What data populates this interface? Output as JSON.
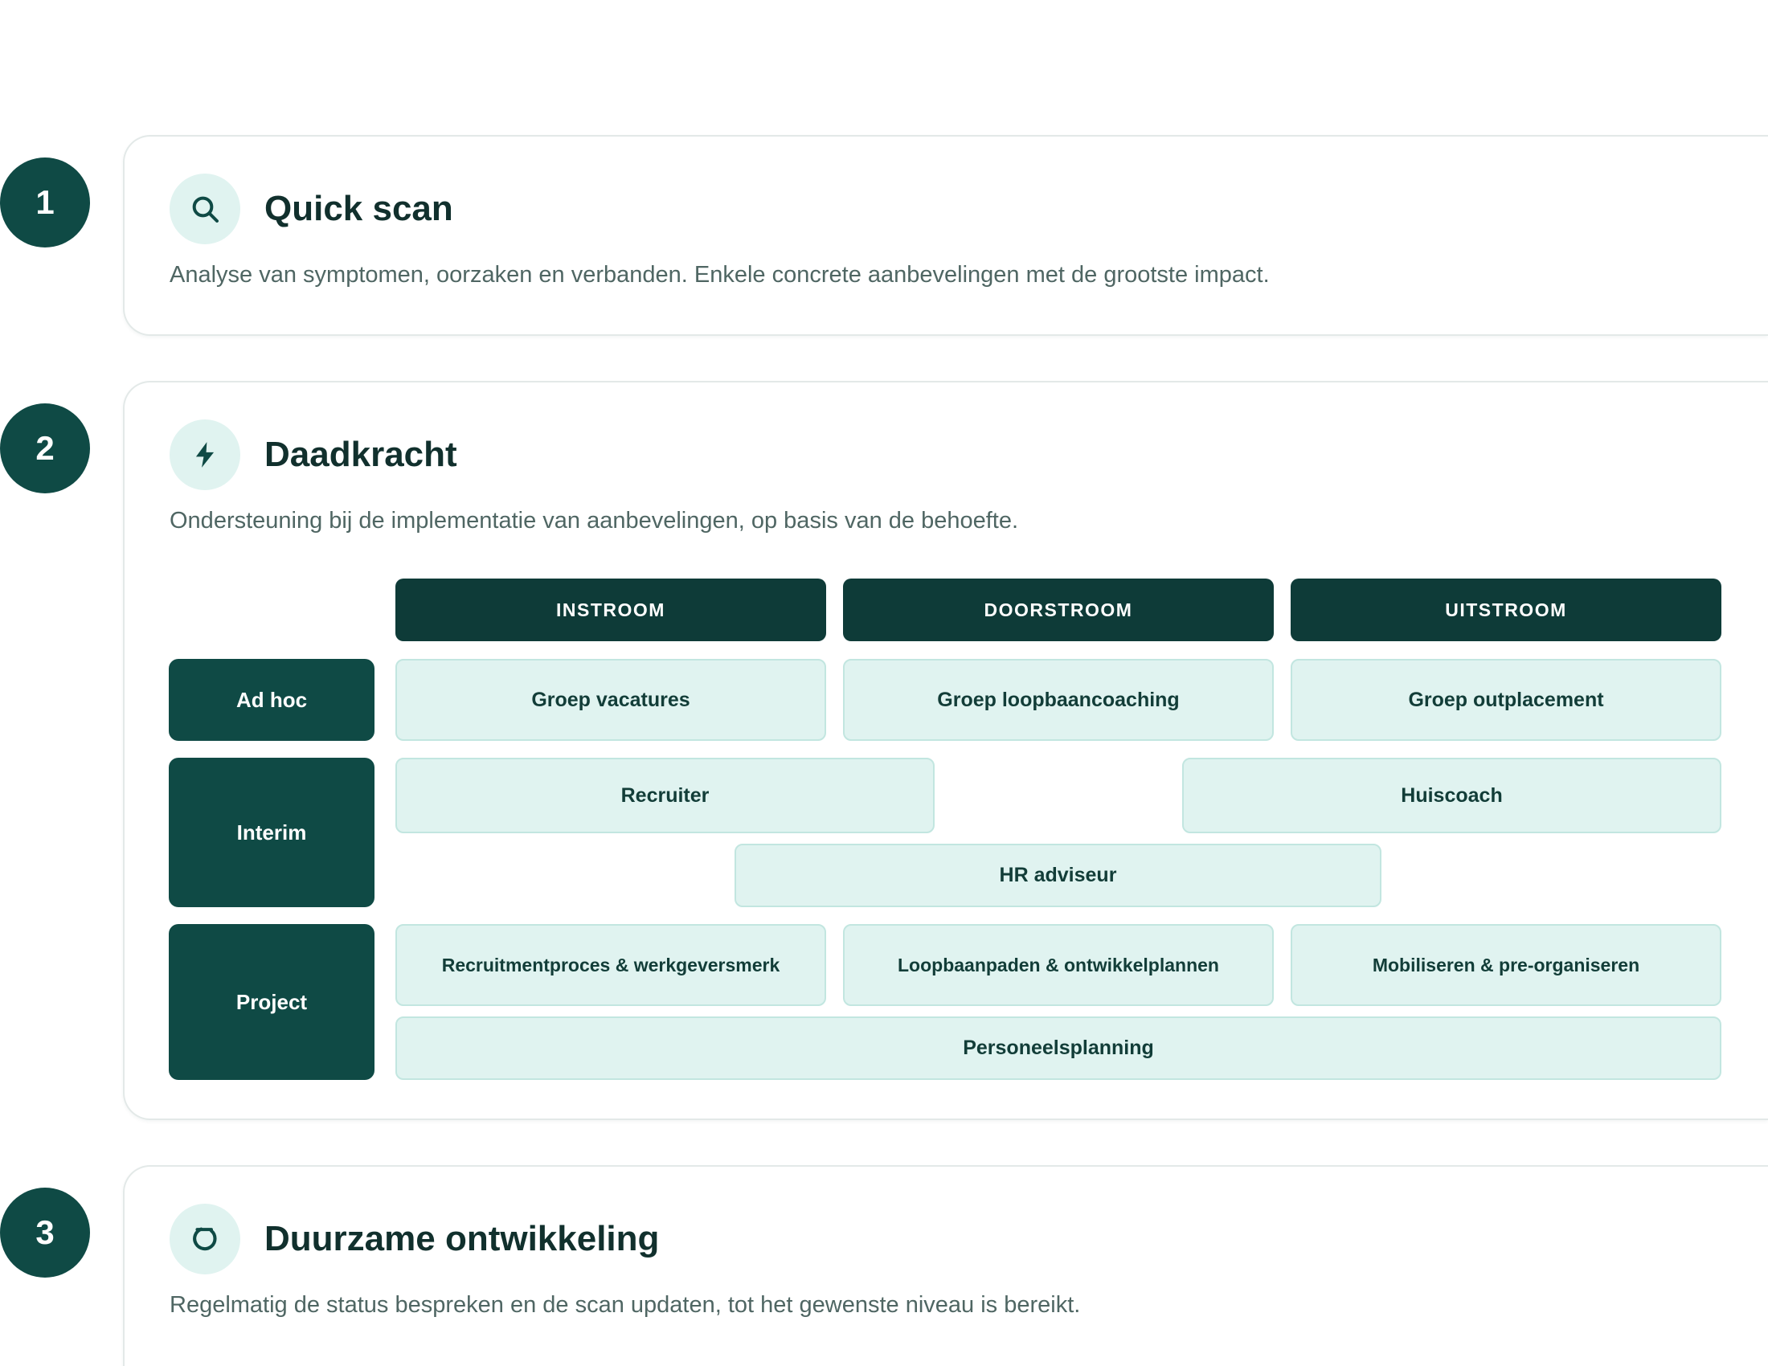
{
  "steps": [
    {
      "number": "1",
      "icon": "search-icon",
      "title": "Quick scan",
      "description": "Analyse van symptomen, oorzaken en verbanden. Enkele concrete aanbevelingen met de grootste impact."
    },
    {
      "number": "2",
      "icon": "lightning-icon",
      "title": "Daadkracht",
      "description": "Ondersteuning bij de implementatie van aanbevelingen, op basis van de behoefte."
    },
    {
      "number": "3",
      "icon": "cycle-icon",
      "title": "Duurzame ontwikkeling",
      "description": "Regelmatig de status bespreken en de scan updaten, tot het gewenste niveau is bereikt."
    }
  ],
  "matrix": {
    "columns": [
      "INSTROOM",
      "DOORSTROOM",
      "UITSTROOM"
    ],
    "rows": [
      "Ad hoc",
      "Interim",
      "Project"
    ],
    "ad_hoc": [
      "Groep vacatures",
      "Groep loopbaancoaching",
      "Groep outplacement"
    ],
    "interim": [
      "Recruiter",
      "Huiscoach",
      "HR adviseur"
    ],
    "project": [
      "Recruitmentproces & werkgeversmerk",
      "Loopbaanpaden & ontwikkelplannen",
      "Mobiliseren & pre-organiseren",
      "Personeelsplanning"
    ]
  },
  "colors": {
    "primary": "#0f4a45",
    "header": "#0e3b38",
    "box_fill": "#e0f3f0",
    "box_border": "#c2e6e0",
    "text_muted": "#4f6663"
  }
}
